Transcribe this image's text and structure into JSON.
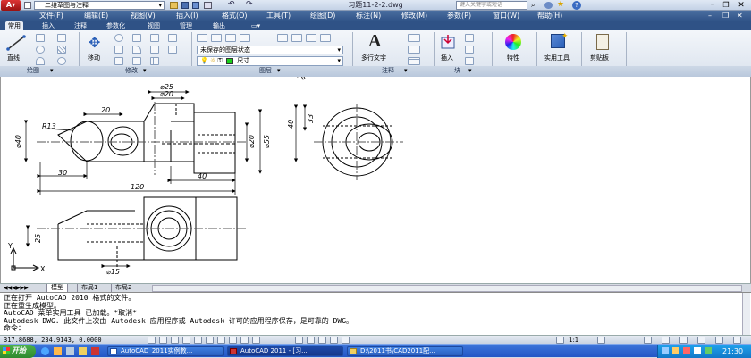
{
  "title_bar": {
    "workspace": "二维草图与注释",
    "document_title": "习题11-2-2.dwg",
    "search_placeholder": "键入关键字或短语"
  },
  "menu": [
    "文件(F)",
    "编辑(E)",
    "视图(V)",
    "插入(I)",
    "格式(O)",
    "工具(T)",
    "绘图(D)",
    "标注(N)",
    "修改(M)",
    "参数(P)",
    "窗口(W)",
    "帮助(H)"
  ],
  "ribbon_tabs": [
    "常用",
    "插入",
    "注释",
    "参数化",
    "视图",
    "管理",
    "输出"
  ],
  "ribbon": {
    "line_label": "直线",
    "move_label": "移动",
    "layer_state": "未保存的图层状态",
    "layer_current": "尺寸",
    "mtext_label": "多行文字",
    "insert_label": "插入",
    "properties_label": "特性",
    "utilities_label": "实用工具",
    "clipboard_label": "剪贴板",
    "panels": [
      "绘图",
      "修改",
      "图层",
      "注释",
      "块"
    ]
  },
  "drawing": {
    "dims": {
      "d25": "⌀25",
      "d20_top": "⌀20",
      "d20_side": "⌀20",
      "w20": "20",
      "r13": "R13",
      "d40": "⌀40",
      "d55": "⌀55",
      "w30": "30",
      "w40": "40",
      "w120": "120",
      "h40": "40",
      "h33": "33",
      "h25": "25",
      "d15": "⌀15"
    },
    "ucs_y": "Y",
    "ucs_x": "X"
  },
  "layout_tabs": [
    "模型",
    "布局1",
    "布局2"
  ],
  "command_lines": [
    "正在打开 AutoCAD 2010 格式的文件。",
    "正在重生成模型。",
    "AutoCAD 菜单实用工具 已加载。*取消*",
    "Autodesk DWG.   此文件上次由 Autodesk 应用程序或 Autodesk 许可的应用程序保存，是可靠的 DWG。",
    "命令："
  ],
  "status": {
    "coordinates": "317.8688, 234.9143, 0.0000",
    "annotation_scale": "1:1"
  },
  "taskbar": {
    "start_label": "开始",
    "tasks": [
      "AutoCAD_2011实例教...",
      "AutoCAD 2011 - [习...",
      "D:\\2011书\\CAD2011配..."
    ],
    "clock": "21:30"
  },
  "colors": {
    "ribbon_blue": "#2f5286",
    "taskbar_blue": "#2356c6",
    "start_green": "#3c9a3c"
  }
}
